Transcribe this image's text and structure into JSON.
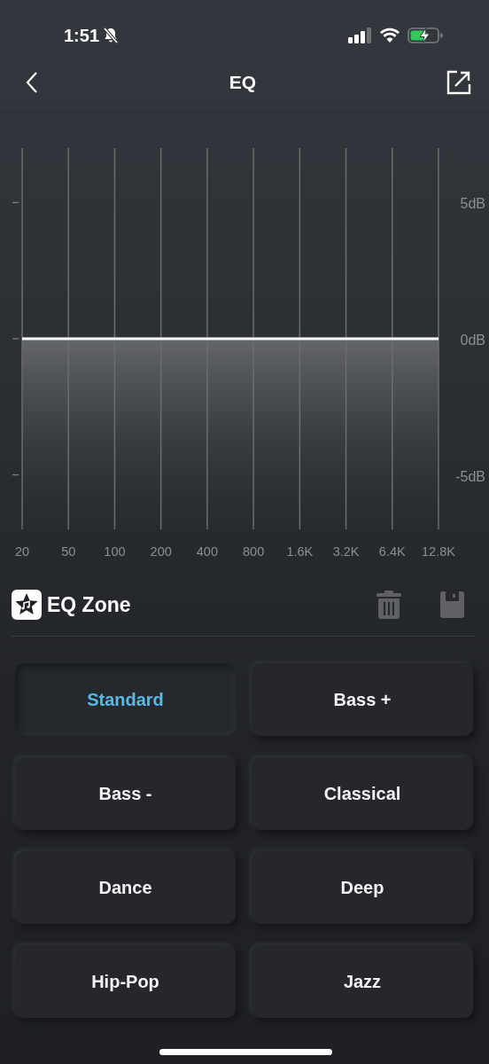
{
  "status_bar": {
    "time": "1:51",
    "silent": true,
    "charging": true
  },
  "nav": {
    "title": "EQ"
  },
  "eq_chart": {
    "chart_data": {
      "type": "line",
      "grid": true,
      "categories": [
        "20",
        "50",
        "100",
        "200",
        "400",
        "800",
        "1.6K",
        "3.2K",
        "6.4K",
        "12.8K"
      ],
      "series": [
        {
          "color": "#ffffff",
          "values": [
            0,
            0,
            0,
            0,
            0,
            0,
            0,
            0,
            0,
            0
          ]
        }
      ],
      "ylim": [
        -7,
        7
      ],
      "yticks": [
        {
          "value": 5,
          "label": "5dB"
        },
        {
          "value": 0,
          "label": "0dB"
        },
        {
          "value": -5,
          "label": "-5dB"
        }
      ]
    }
  },
  "zone": {
    "title": "EQ Zone"
  },
  "presets": [
    {
      "label": "Standard",
      "selected": true
    },
    {
      "label": "Bass +",
      "selected": false
    },
    {
      "label": "Bass -",
      "selected": false
    },
    {
      "label": "Classical",
      "selected": false
    },
    {
      "label": "Dance",
      "selected": false
    },
    {
      "label": "Deep",
      "selected": false
    },
    {
      "label": "Hip-Pop",
      "selected": false
    },
    {
      "label": "Jazz",
      "selected": false
    }
  ]
}
